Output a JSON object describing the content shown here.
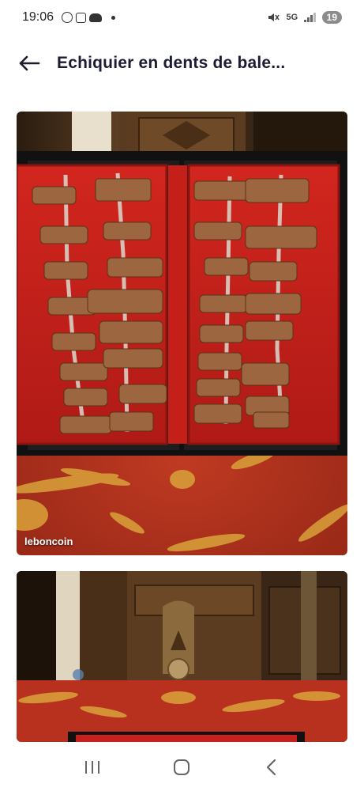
{
  "status_bar": {
    "time": "19:06",
    "network": "5G",
    "battery": "19"
  },
  "header": {
    "back_icon": "arrow-left-icon",
    "title": "Echiquier en dents de bale..."
  },
  "gallery": {
    "watermark": "leboncoin",
    "images": [
      {
        "description_icon": "chess-set-photo"
      },
      {
        "description_icon": "chess-box-photo"
      }
    ]
  },
  "nav_bar": {
    "recents_icon": "recents-icon",
    "home_icon": "home-icon",
    "back_icon": "back-chevron-icon"
  },
  "colors": {
    "title": "#1b1b33",
    "velvet": "#c8201c",
    "box": "#1a1a1a",
    "tablecloth": "#b8301e"
  }
}
